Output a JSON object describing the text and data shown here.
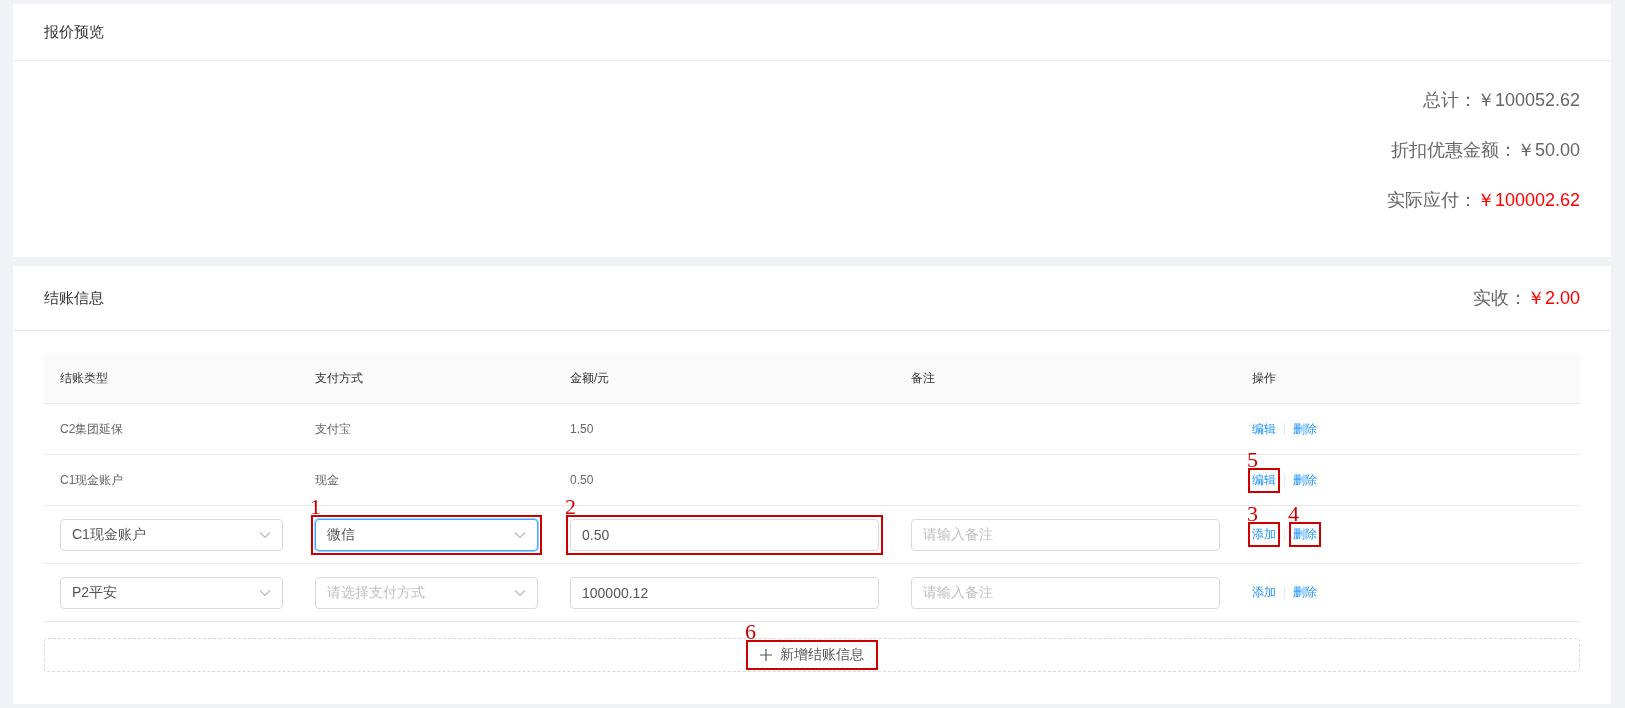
{
  "quote_preview": {
    "title": "报价预览",
    "totals": [
      {
        "label": "总计：",
        "value": "￥100052.62",
        "highlight": false
      },
      {
        "label": "折扣优惠金额：",
        "value": "￥50.00",
        "highlight": false
      },
      {
        "label": "实际应付：",
        "value": "￥100002.62",
        "highlight": true
      }
    ]
  },
  "settlement": {
    "title": "结账信息",
    "received": {
      "label": "实收：",
      "value": "￥2.00"
    },
    "table": {
      "columns": [
        "结账类型",
        "支付方式",
        "金额/元",
        "备注",
        "操作"
      ],
      "rows": [
        {
          "kind": "text",
          "type": "C2集团延保",
          "payment": "支付宝",
          "amount": "1.50",
          "actions": [
            {
              "label": "编辑"
            },
            {
              "label": "删除"
            }
          ]
        },
        {
          "kind": "text",
          "type": "C1现金账户",
          "payment": "现金",
          "amount": "0.50",
          "actions": [
            {
              "label": "编辑",
              "annotation": "5"
            },
            {
              "label": "删除"
            }
          ]
        },
        {
          "kind": "edit",
          "type": {
            "value": "C1现金账户",
            "focused": false
          },
          "payment": {
            "value": "微信",
            "focused": true,
            "annotation": "1"
          },
          "amount": {
            "value": "0.50",
            "annotation": "2"
          },
          "note": {
            "placeholder": "请输入备注"
          },
          "actions": [
            {
              "label": "添加",
              "annotation": "3"
            },
            {
              "label": "删除",
              "annotation": "4"
            }
          ]
        },
        {
          "kind": "edit",
          "type": {
            "value": "P2平安",
            "focused": false
          },
          "payment": {
            "placeholder": "请选择支付方式",
            "focused": false
          },
          "amount": {
            "value": "100000.12"
          },
          "note": {
            "placeholder": "请输入备注"
          },
          "actions": [
            {
              "label": "添加"
            },
            {
              "label": "删除"
            }
          ]
        }
      ]
    },
    "add_button": {
      "label": "新增结账信息",
      "annotation": "6"
    }
  }
}
